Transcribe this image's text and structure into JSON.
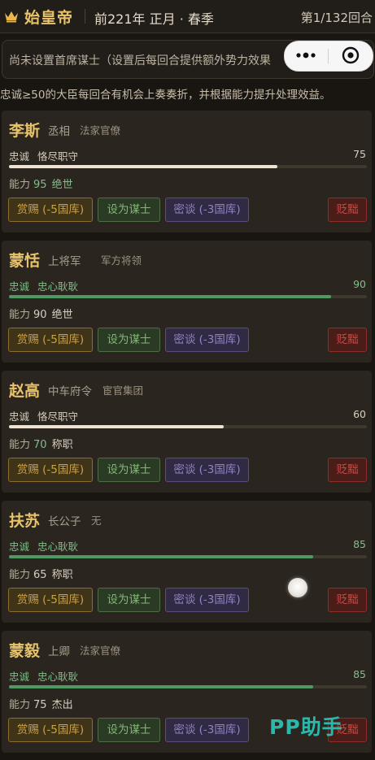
{
  "header": {
    "crown_icon": "crown-icon",
    "title": "始皇帝",
    "date": "前221年 正月 · 春季",
    "round": "第1/132回合"
  },
  "advisor_bar": {
    "text": "尚未设置首席谋士（设置后每回合提供额外势力效果"
  },
  "mini_program_capsule": {
    "more_icon": "more-dots-icon",
    "close_icon": "target-circle-icon"
  },
  "notice": "忠诚≥50的大臣每回合有机会上奏奏折，并根据能力提升处理效益。",
  "buttons": {
    "reward": "赏赐 (-5国库)",
    "set_advisor": "设为谋士",
    "secret_talk": "密谈 (-3国库)",
    "demote": "贬黜"
  },
  "labels": {
    "loyalty": "忠诚",
    "ability": "能力"
  },
  "colors": {
    "gold_text": "#e8c36a",
    "loyalty_high": "#4f9a63",
    "loyalty_normal": "#ede3d2",
    "card_bg": "#2a251e"
  },
  "ministers": [
    {
      "name": "李斯",
      "rank": "丞相",
      "faction": "法家官僚",
      "loyalty": 75,
      "loyalty_desc": "恪尽职守",
      "loyalty_level": "normal",
      "ability": 95,
      "ability_grade": "绝世"
    },
    {
      "name": "蒙恬",
      "rank": "上将军",
      "faction": "军方将领",
      "loyalty": 90,
      "loyalty_desc": "忠心耿耿",
      "loyalty_level": "high",
      "ability": 90,
      "ability_grade": "绝世"
    },
    {
      "name": "赵高",
      "rank": "中车府令",
      "faction": "宦官集团",
      "loyalty": 60,
      "loyalty_desc": "恪尽职守",
      "loyalty_level": "normal",
      "ability": 70,
      "ability_grade": "称职"
    },
    {
      "name": "扶苏",
      "rank": "长公子",
      "faction": "无",
      "loyalty": 85,
      "loyalty_desc": "忠心耿耿",
      "loyalty_level": "high",
      "ability": 65,
      "ability_grade": "称职"
    },
    {
      "name": "蒙毅",
      "rank": "上卿",
      "faction": "法家官僚",
      "loyalty": 85,
      "loyalty_desc": "忠心耿耿",
      "loyalty_level": "high",
      "ability": 75,
      "ability_grade": "杰出"
    }
  ],
  "watermark": "PP助手"
}
